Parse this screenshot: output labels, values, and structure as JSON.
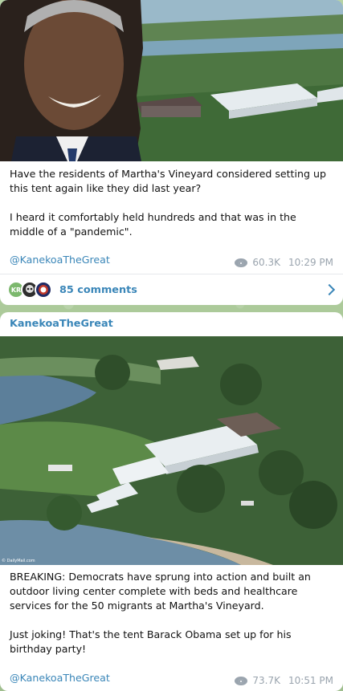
{
  "post1": {
    "text": "Have the residents of Martha's Vineyard considered setting up this tent again like they did last year?\n\nI heard it comfortably held hundreds and that was in the middle of a \"pandemic\".",
    "handle": "@KanekoaTheGreat",
    "views": "60.3K",
    "time": "10:29 PM",
    "comments": {
      "label": "85 comments",
      "avatars": [
        "KR",
        "",
        ""
      ]
    }
  },
  "post2": {
    "channel": "KanekoaTheGreat",
    "photo_credit": "© DailyMail.com",
    "text": "BREAKING: Democrats have sprung into action and built an outdoor living center complete with beds and healthcare services for the 50 migrants at Martha's Vineyard.\n\nJust joking! That's the tent Barack Obama set up for his birthday party!",
    "handle": "@KanekoaTheGreat",
    "views": "73.7K",
    "time": "10:51 PM"
  },
  "colors": {
    "link": "#3a86b8",
    "meta": "#9aa4ae",
    "background": "#a9c79a"
  }
}
